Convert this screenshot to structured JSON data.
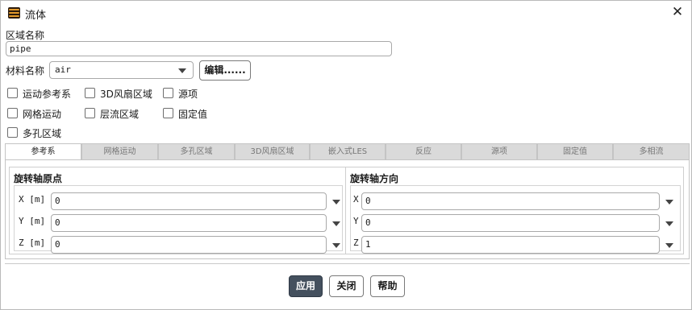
{
  "window": {
    "title": "流体"
  },
  "zone_name": {
    "label": "区域名称",
    "value": "pipe"
  },
  "material": {
    "label": "材料名称",
    "value": "air",
    "edit_label": "编辑......"
  },
  "checkboxes": {
    "moving_ref": "运动参考系",
    "fan_3d": "3D风扇区域",
    "source": "源项",
    "mesh_motion": "网格运动",
    "laminar": "层流区域",
    "fixed": "固定值",
    "porous": "多孔区域"
  },
  "tabs": [
    "参考系",
    "网格运动",
    "多孔区域",
    "3D风扇区域",
    "嵌入式LES",
    "反应",
    "源项",
    "固定值",
    "多相流"
  ],
  "origin": {
    "title": "旋转轴原点",
    "rows": [
      {
        "label": "X [m]",
        "value": "0"
      },
      {
        "label": "Y [m]",
        "value": "0"
      },
      {
        "label": "Z [m]",
        "value": "0"
      }
    ]
  },
  "direction": {
    "title": "旋转轴方向",
    "rows": [
      {
        "label": "X",
        "value": "0"
      },
      {
        "label": "Y",
        "value": "0"
      },
      {
        "label": "Z",
        "value": "1"
      }
    ]
  },
  "buttons": {
    "apply": "应用",
    "close": "关闭",
    "help": "帮助"
  },
  "icons": {
    "app": "fluent-app-icon",
    "close": "close-icon",
    "dropdown": "chevron-down-icon"
  }
}
